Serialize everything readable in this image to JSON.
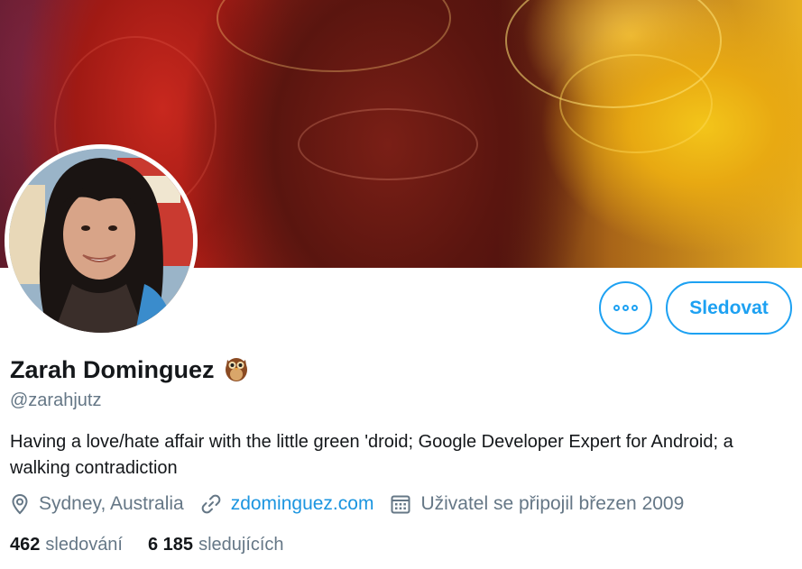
{
  "profile": {
    "display_name": "Zarah Dominguez",
    "name_emoji": "owl",
    "handle": "@zarahjutz",
    "bio": "Having a love/hate affair with the little green 'droid; Google Developer Expert for Android; a walking contradiction",
    "location": "Sydney, Australia",
    "website": "zdominguez.com",
    "joined": "Uživatel se připojil březen 2009"
  },
  "actions": {
    "more_icon": "more-horizontal-icon",
    "follow_label": "Sledovat"
  },
  "stats": {
    "following_count": "462",
    "following_label": "sledování",
    "followers_count": "6 185",
    "followers_label": "sledujících"
  },
  "icons": {
    "location": "location-pin-icon",
    "link": "link-icon",
    "calendar": "calendar-icon"
  },
  "colors": {
    "accent": "#1da1f2",
    "link": "#1b95e0",
    "secondary_text": "#657786",
    "primary_text": "#14171a"
  }
}
